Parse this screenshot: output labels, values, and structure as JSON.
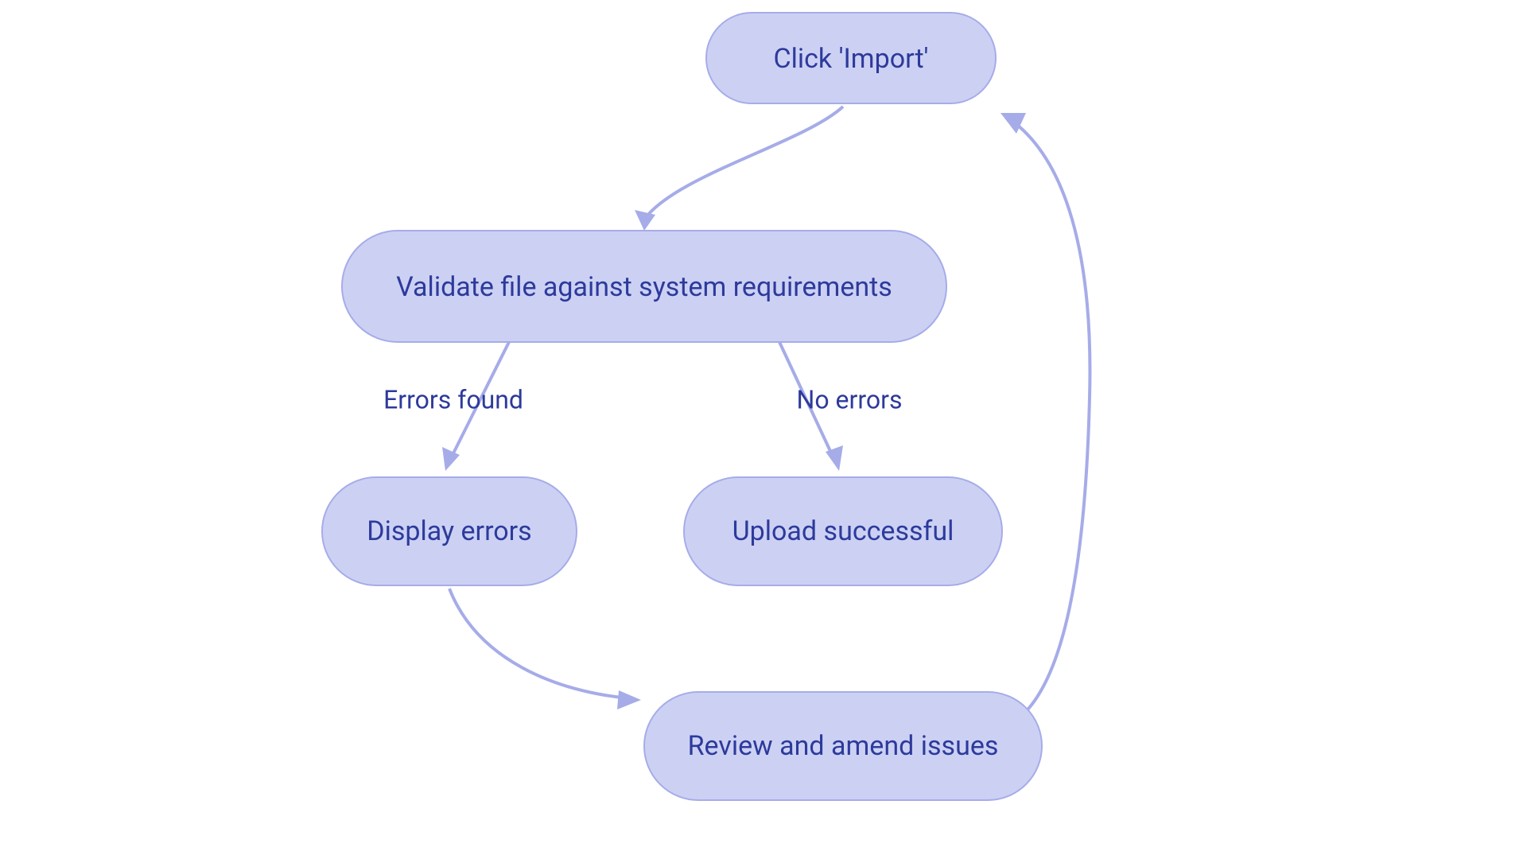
{
  "diagram": {
    "type": "flowchart",
    "nodes": {
      "import": {
        "label": "Click 'Import'"
      },
      "validate": {
        "label": "Validate file against system requirements"
      },
      "display": {
        "label": "Display errors"
      },
      "upload": {
        "label": "Upload successful"
      },
      "review": {
        "label": "Review and amend issues"
      }
    },
    "edges": {
      "import_to_validate": {
        "from": "import",
        "to": "validate",
        "label": ""
      },
      "validate_to_display": {
        "from": "validate",
        "to": "display",
        "label": "Errors found"
      },
      "validate_to_upload": {
        "from": "validate",
        "to": "upload",
        "label": "No errors"
      },
      "display_to_review": {
        "from": "display",
        "to": "review",
        "label": ""
      },
      "review_to_import": {
        "from": "review",
        "to": "import",
        "label": ""
      }
    },
    "colors": {
      "node_fill": "#ccd1f4",
      "node_stroke": "#a6ace8",
      "edge_stroke": "#a6ace8",
      "text": "#2d3a9b"
    }
  }
}
